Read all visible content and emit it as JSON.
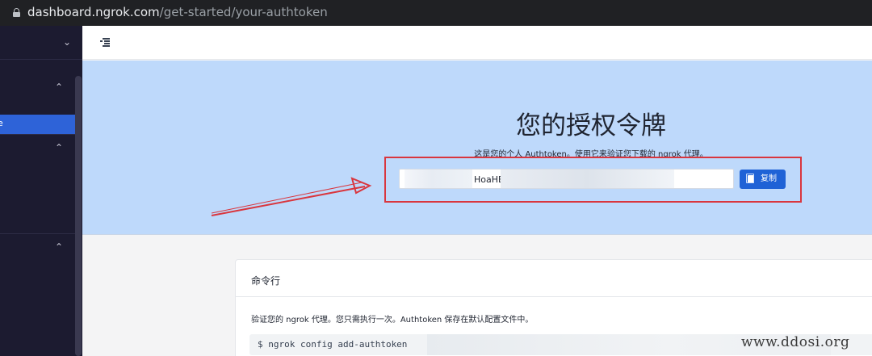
{
  "browser": {
    "url_host": "dashboard.ngrok.com",
    "url_path": "/get-started/your-authtoken",
    "lock_icon": "lock-icon"
  },
  "sidebar": {
    "active_item_label": "e",
    "icons": [
      "chevron-down-icon",
      "chevron-up-icon",
      "chevron-up-icon",
      "chevron-up-icon"
    ]
  },
  "topbar": {
    "menu_icon": "menu-collapse-icon"
  },
  "hero": {
    "title": "您的授权令牌",
    "subtitle": "这是您的个人 Authtoken。使用它来验证您下载的 ngrok 代理。",
    "token_visible_fragment": "HoaHE",
    "copy_label": "复制",
    "copy_icon": "copy-icon"
  },
  "card": {
    "title": "命令行",
    "description": "验证您的 ngrok 代理。您只需执行一次。Authtoken 保存在默认配置文件中。",
    "command": "$ ngrok config add-authtoken"
  },
  "annotation": {
    "highlight_color": "#d9363e"
  },
  "watermark": {
    "text": "www.ddosi.org"
  },
  "colors": {
    "sidebar_bg": "#1c1b30",
    "hero_bg": "#bed9fb",
    "accent": "#1f62d6"
  }
}
